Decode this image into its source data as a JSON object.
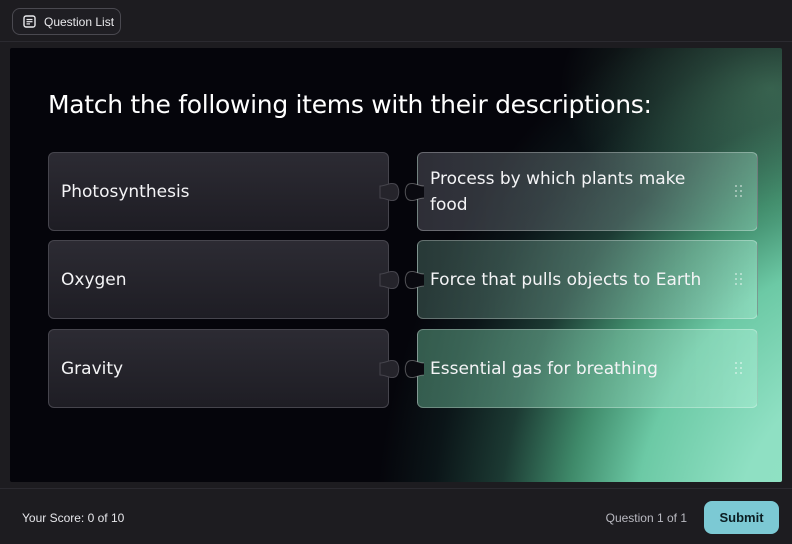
{
  "header": {
    "question_list_label": "Question List",
    "question_list_icon": "list-document-icon"
  },
  "question": {
    "prompt": "Match the following items with their descriptions:"
  },
  "pairs": {
    "left": [
      "Photosynthesis",
      "Oxygen",
      "Gravity"
    ],
    "right": [
      "Process by which plants make food",
      "Force that pulls objects to Earth",
      "Essential gas for breathing"
    ]
  },
  "footer": {
    "score_text": "Your Score: 0 of 10",
    "question_counter": "Question 1 of 1",
    "submit_label": "Submit"
  },
  "colors": {
    "accent": "#7cc9d4",
    "background": "#1d1c20",
    "stage_glow": "#8fe4c4"
  }
}
